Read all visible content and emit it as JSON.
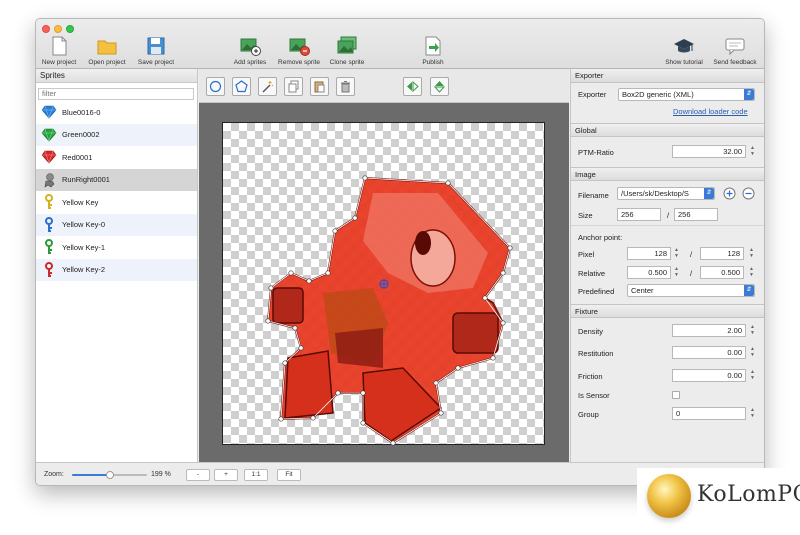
{
  "window": {
    "toolbar": [
      {
        "name": "new-project-button",
        "icon": "new-document-icon",
        "label": "New project"
      },
      {
        "name": "open-project-button",
        "icon": "folder-icon",
        "label": "Open project"
      },
      {
        "name": "save-project-button",
        "icon": "floppy-disk-icon",
        "label": "Save project"
      },
      {
        "name": "add-sprites-button",
        "icon": "add-image-icon",
        "label": "Add sprites"
      },
      {
        "name": "remove-sprite-button",
        "icon": "remove-image-icon",
        "label": "Remove sprite"
      },
      {
        "name": "clone-sprite-button",
        "icon": "clone-image-icon",
        "label": "Clone sprite"
      },
      {
        "name": "publish-button",
        "icon": "publish-icon",
        "label": "Publish"
      },
      {
        "name": "show-tutorial-button",
        "icon": "graduation-cap-icon",
        "label": "Show tutorial"
      },
      {
        "name": "send-feedback-button",
        "icon": "speech-bubble-icon",
        "label": "Send feedback"
      }
    ]
  },
  "sidebar": {
    "title": "Sprites",
    "filter_placeholder": "filter",
    "items": [
      {
        "label": "Blue0016-0",
        "icon": "blue-gem-icon",
        "color": "#2a7fd9"
      },
      {
        "label": "Green0002",
        "icon": "green-gem-icon",
        "color": "#23a33a"
      },
      {
        "label": "Red0001",
        "icon": "red-gem-icon",
        "color": "#d62828"
      },
      {
        "label": "RunRight0001",
        "icon": "character-icon",
        "color": "#777777"
      },
      {
        "label": "Yellow Key",
        "icon": "yellow-key-icon",
        "color": "#d4b21c"
      },
      {
        "label": "Yellow Key-0",
        "icon": "blue-key-icon",
        "color": "#2a6fd0"
      },
      {
        "label": "Yellow Key-1",
        "icon": "green-key-icon",
        "color": "#2a9a3a"
      },
      {
        "label": "Yellow Key-2",
        "icon": "red-key-icon",
        "color": "#cc2a2a"
      }
    ]
  },
  "editor": {
    "tools": [
      {
        "name": "circle-tool",
        "icon": "circle-icon"
      },
      {
        "name": "polygon-tool",
        "icon": "pentagon-icon"
      },
      {
        "name": "magic-wand-tool",
        "icon": "magic-wand-icon"
      },
      {
        "name": "copy-tool",
        "icon": "copy-icon"
      },
      {
        "name": "paste-tool",
        "icon": "paste-icon"
      },
      {
        "name": "delete-tool",
        "icon": "trash-icon"
      },
      {
        "name": "flip-horizontal-tool",
        "icon": "flip-horizontal-icon"
      },
      {
        "name": "flip-vertical-tool",
        "icon": "flip-vertical-icon"
      }
    ],
    "accent": "#3a9a4a"
  },
  "properties": {
    "exporter": {
      "header": "Exporter",
      "label": "Exporter",
      "value": "Box2D generic (XML)",
      "link": "Download loader code"
    },
    "global": {
      "header": "Global",
      "ptm_label": "PTM-Ratio",
      "ptm_value": "32.00"
    },
    "image": {
      "header": "Image",
      "filename_label": "Filename",
      "filename_value": "/Users/sk/Desktop/S",
      "size_label": "Size",
      "size_w": "256",
      "size_h": "256",
      "size_sep": "/",
      "anchor_label": "Anchor point:",
      "pixel_label": "Pixel",
      "pixel_x": "128",
      "pixel_y": "128",
      "relative_label": "Relative",
      "relative_x": "0.500",
      "relative_y": "0.500",
      "predefined_label": "Predefined",
      "predefined_value": "Center"
    },
    "fixture": {
      "header": "Fixture",
      "density_label": "Density",
      "density_value": "2.00",
      "restitution_label": "Restitution",
      "restitution_value": "0.00",
      "friction_label": "Friction",
      "friction_value": "0.00",
      "sensor_label": "Is Sensor",
      "group_label": "Group",
      "group_value": "0"
    }
  },
  "status": {
    "zoom_label": "Zoom:",
    "zoom_value": "199 %",
    "zoom_level": 0.5,
    "minus": "-",
    "plus": "+",
    "one_to_one": "1:1",
    "fit": "Fit"
  },
  "watermark": {
    "text": "KoLomPC"
  }
}
